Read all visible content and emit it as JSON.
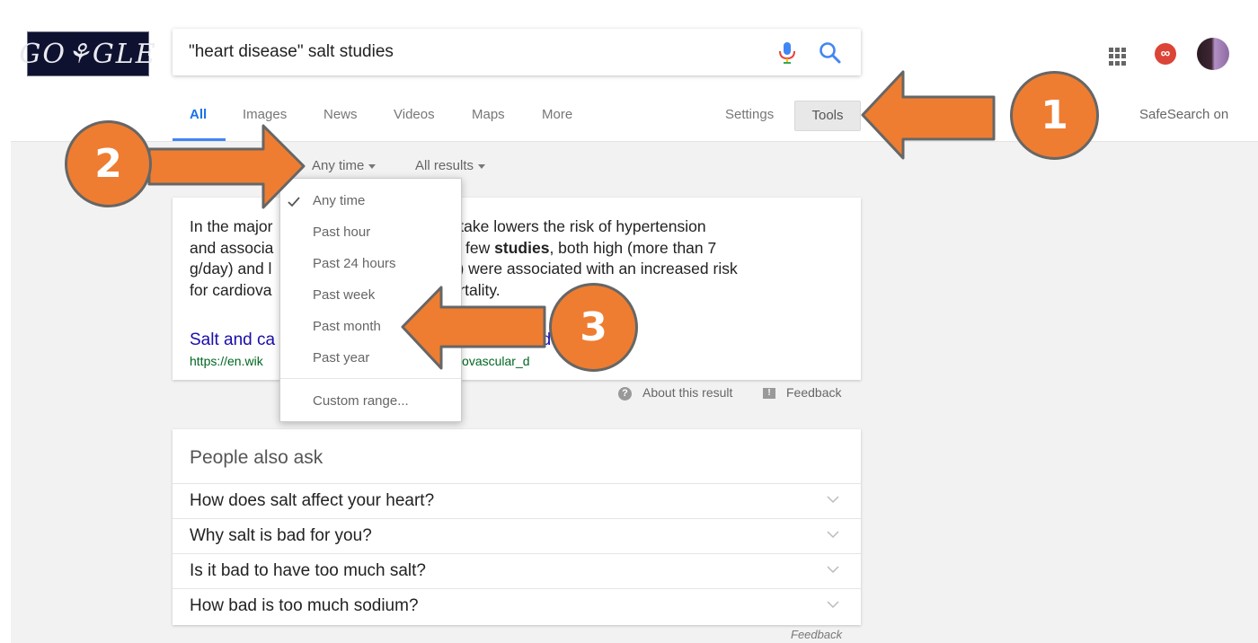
{
  "header": {
    "logo_text": "GO⚘GLE",
    "search_value": "\"heart disease\" salt studies",
    "notif_badge": "∞",
    "tabs": [
      {
        "label": "All",
        "active": true
      },
      {
        "label": "Images"
      },
      {
        "label": "News"
      },
      {
        "label": "Videos"
      },
      {
        "label": "Maps"
      },
      {
        "label": "More"
      }
    ],
    "settings_label": "Settings",
    "tools_label": "Tools",
    "safesearch_label": "SafeSearch on"
  },
  "tools_row": {
    "time_filter": "Any time",
    "results_filter": "All results"
  },
  "time_dropdown": {
    "items": [
      "Any time",
      "Past hour",
      "Past 24 hours",
      "Past week",
      "Past month",
      "Past year"
    ],
    "selected": "Any time",
    "custom_range": "Custom range..."
  },
  "snippet": {
    "line1": "In the major",
    "line1_tail": "sodium intake lowers the risk of hypertension",
    "line2": "and associa",
    "line2_tail": "rders. In a few ",
    "line2_bold": "studies",
    "line2_end": ", both high (more than 7",
    "line3": "g/day) and l",
    "line3_tail": "n 3 g/day) were associated with an increased risk",
    "line4": "for cardiova",
    "line4_tail": "eased mortality.",
    "link_text": "Salt and ca",
    "link_tail": "ed",
    "url": "https://en.wik",
    "url_tail": "ardiovascular_d"
  },
  "about_label": "About this result",
  "feedback_label": "Feedback",
  "people_also_ask": {
    "title": "People also ask",
    "questions": [
      "How does salt affect your heart?",
      "Why salt is bad for you?",
      "Is it bad to have too much salt?",
      "How bad is too much sodium?"
    ]
  },
  "feedback_bottom": "Feedback",
  "annotations": {
    "step1": "1",
    "step2": "2",
    "step3": "3",
    "arrow_color": "#ee7d31"
  }
}
